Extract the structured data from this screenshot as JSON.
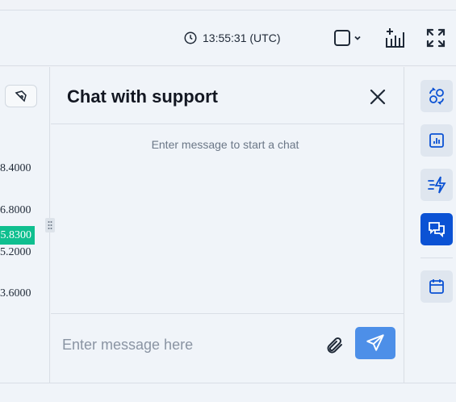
{
  "toolbar": {
    "clock_text": "13:55:31 (UTC)",
    "icons": [
      "clock-icon",
      "layout-square-icon",
      "chevron-down-icon",
      "add-indicator-icon",
      "fullscreen-icon"
    ]
  },
  "chart": {
    "prices": [
      "8.4000",
      "6.8000",
      "5.2000",
      "3.6000"
    ],
    "current_price": "5.8300",
    "accent_color": "#0fbf8f"
  },
  "chat": {
    "title": "Chat with support",
    "empty_text": "Enter message to start a chat",
    "input_placeholder": "Enter message here",
    "input_value": "",
    "send_color": "#4d8fe8"
  },
  "rail": {
    "items": [
      "exchange-icon",
      "chart-report-icon",
      "fast-trade-icon",
      "chat-icon",
      "calendar-icon"
    ],
    "active_color": "#0b52d4"
  }
}
